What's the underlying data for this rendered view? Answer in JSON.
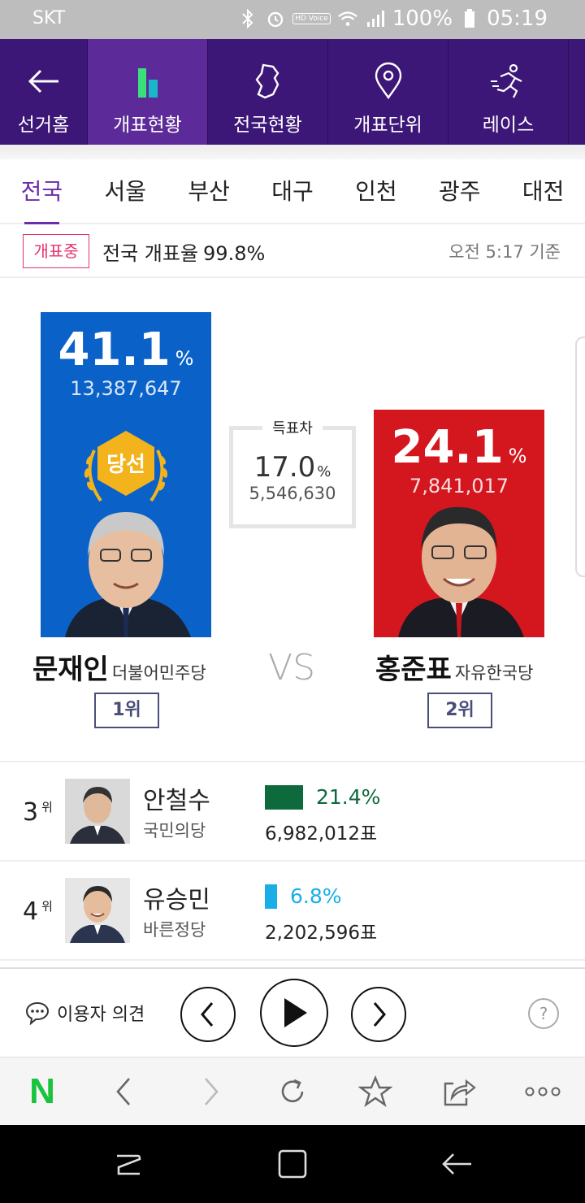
{
  "status_bar": {
    "carrier": "SKT",
    "hd_label": "HD Voice",
    "battery": "100%",
    "time": "05:19"
  },
  "top_nav": {
    "items": [
      {
        "label": "선거홈",
        "icon": "back-arrow-icon"
      },
      {
        "label": "개표현황",
        "icon": "bar-chart-icon"
      },
      {
        "label": "전국현황",
        "icon": "korea-map-icon"
      },
      {
        "label": "개표단위",
        "icon": "location-pin-icon"
      },
      {
        "label": "레이스",
        "icon": "runner-icon"
      }
    ],
    "active_index": 1,
    "active_color": "#5d2b99",
    "bg_color": "#3d1778"
  },
  "region_tabs": [
    "전국",
    "서울",
    "부산",
    "대구",
    "인천",
    "광주",
    "대전"
  ],
  "counting": {
    "badge": "개표중",
    "label": "전국 개표율",
    "rate": "99.8%",
    "time": "오전 5:17 기준"
  },
  "candidates_main": [
    {
      "name": "문재인",
      "party": "더불어민주당",
      "pct": "41.1",
      "pct_unit": "%",
      "votes": "13,387,647",
      "rank": "1위",
      "winner_label": "당선",
      "color": "#0a62c9"
    },
    {
      "name": "홍준표",
      "party": "자유한국당",
      "pct": "24.1",
      "pct_unit": "%",
      "votes": "7,841,017",
      "rank": "2위",
      "color": "#d4161f"
    }
  ],
  "difference": {
    "title": "득표차",
    "pct": "17.0",
    "pct_unit": "%",
    "votes": "5,546,630"
  },
  "vs_label": "VS",
  "other_candidates": [
    {
      "rank": "3",
      "rank_unit": "위",
      "name": "안철수",
      "party": "국민의당",
      "pct": "21.4%",
      "pct_value": 21.4,
      "votes": "6,982,012표",
      "color": "#0d6a3c"
    },
    {
      "rank": "4",
      "rank_unit": "위",
      "name": "유승민",
      "party": "바른정당",
      "pct": "6.8%",
      "pct_value": 6.8,
      "votes": "2,202,596표",
      "color": "#19aee8"
    }
  ],
  "player": {
    "opinion_label": "이용자 의견",
    "help": "?"
  },
  "browser": {
    "logo": "N",
    "logo_color": "#19c33b"
  }
}
